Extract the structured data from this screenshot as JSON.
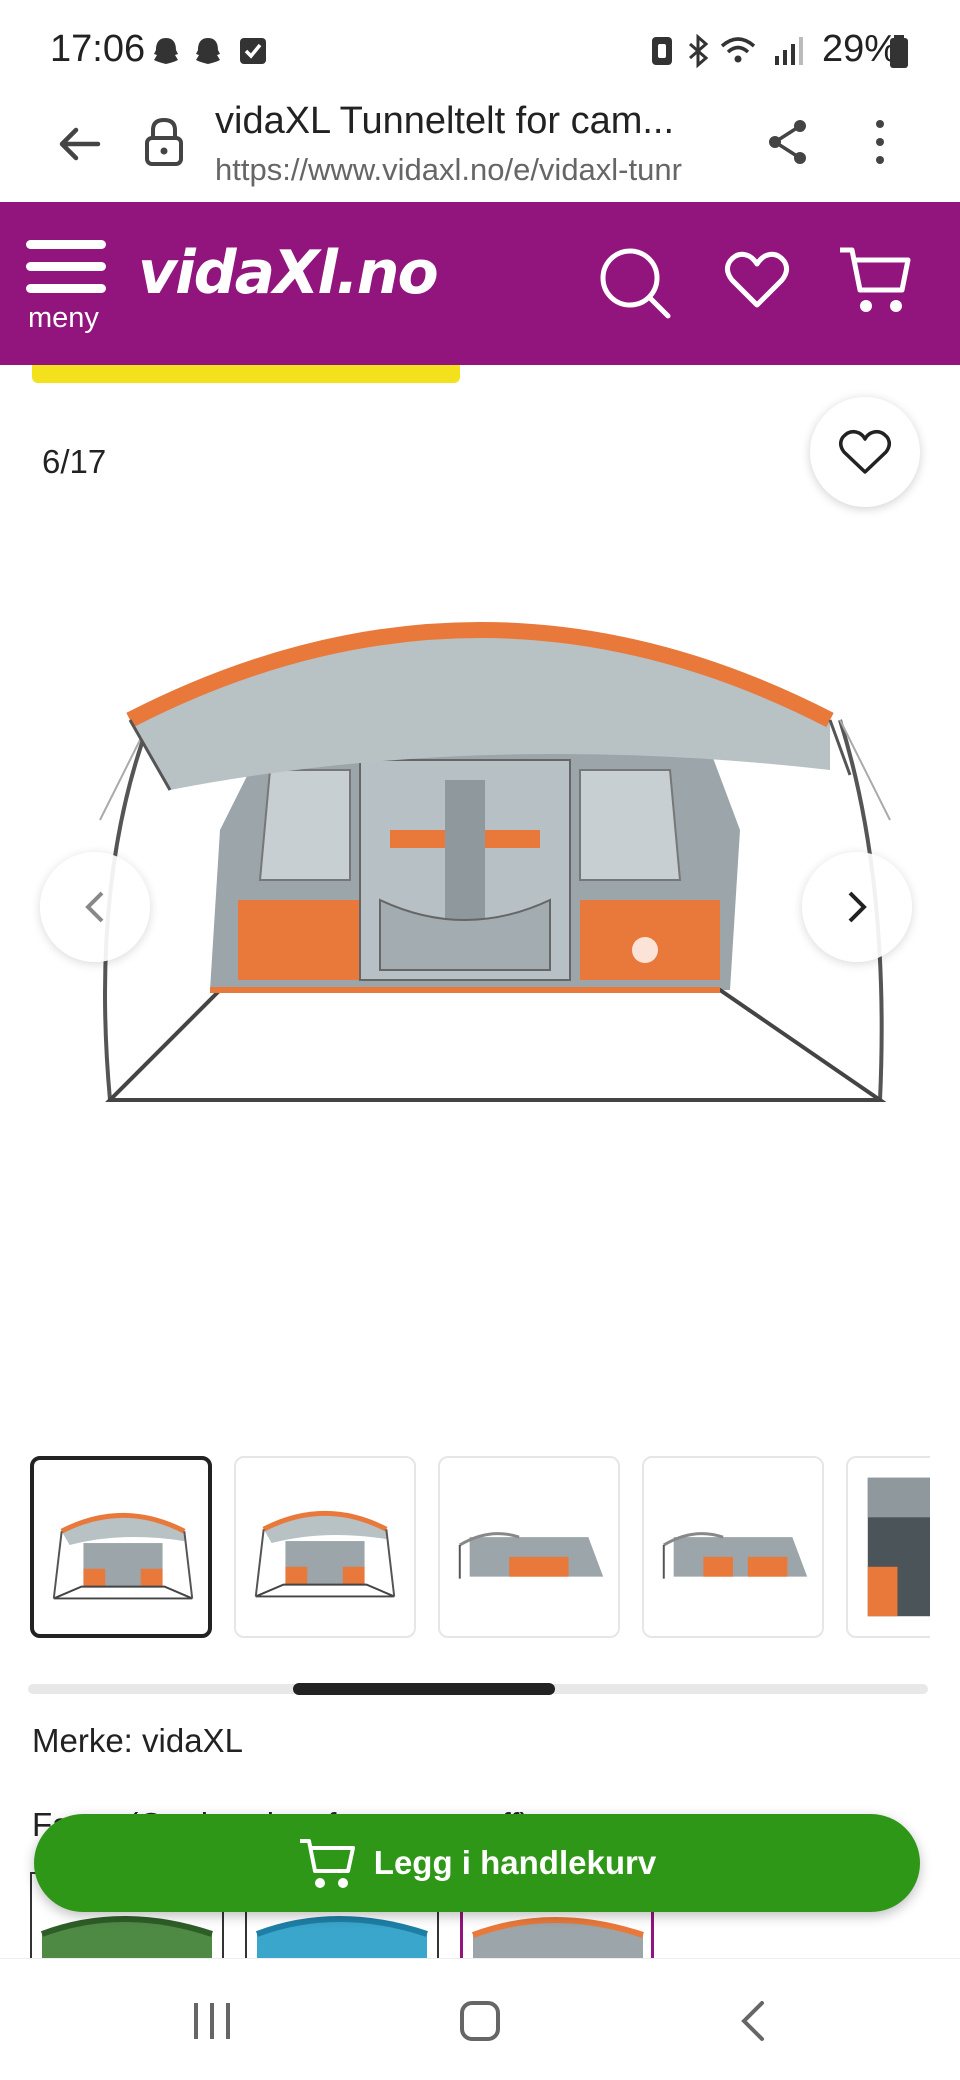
{
  "status_bar": {
    "time": "17:06",
    "battery": "29%",
    "icons": [
      "snapchat-icon",
      "snapchat-icon",
      "checkbox-icon",
      "nfc-icon",
      "bluetooth-icon",
      "wifi-icon",
      "signal-icon",
      "battery-icon"
    ]
  },
  "browser": {
    "title": "vidaXL Tunneltelt for cam...",
    "url": "https://www.vidaxl.no/e/vidaxl-tunr",
    "icons": [
      "back-arrow-icon",
      "lock-icon",
      "share-icon",
      "more-vert-icon"
    ]
  },
  "header": {
    "menu_label": "meny",
    "logo_text": "vidaXl.no",
    "brand_color": "#91157c",
    "icons": [
      "menu-icon",
      "search-icon",
      "heart-icon",
      "cart-icon"
    ]
  },
  "gallery": {
    "counter": "6/17",
    "thumbnails": [
      {
        "name": "thumb-1",
        "active": true
      },
      {
        "name": "thumb-2",
        "active": false
      },
      {
        "name": "thumb-3",
        "active": false
      },
      {
        "name": "thumb-4",
        "active": false
      },
      {
        "name": "thumb-5",
        "active": false
      }
    ]
  },
  "product": {
    "brand_line": "Merke: vidaXL",
    "color_line": "Farge (Oppbrettingsfarge og stoff)"
  },
  "cta": {
    "label": "Legg i handlekurv",
    "color": "#2e9718"
  },
  "colors": {
    "accent": "#91157c",
    "yellow": "#f2e11c",
    "tent_orange": "#e9793a",
    "tent_grey": "#a7b0b4"
  }
}
